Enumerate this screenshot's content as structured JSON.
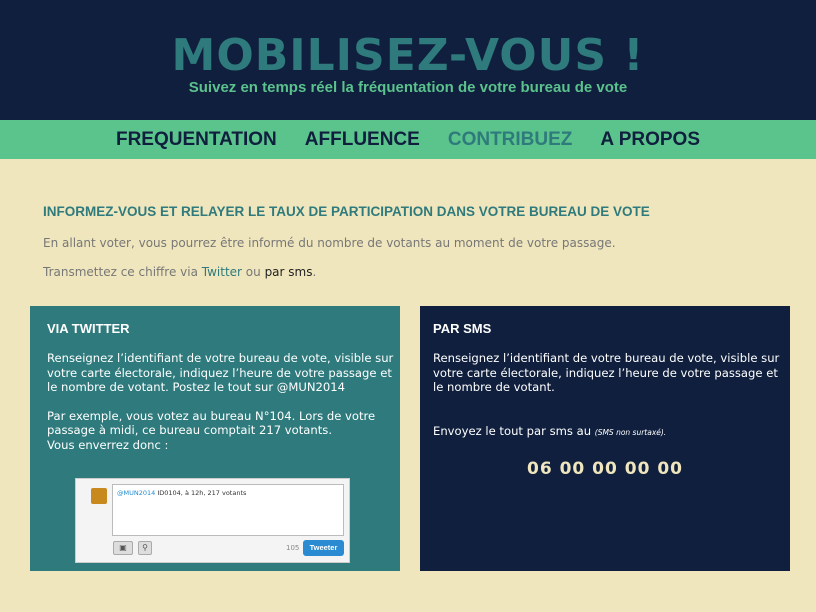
{
  "header": {
    "title": "MOBILISEZ-VOUS !",
    "subtitle": "Suivez en temps réel la fréquentation de votre bureau de vote"
  },
  "nav": {
    "items": [
      {
        "label": "FREQUENTATION",
        "active": false
      },
      {
        "label": "AFFLUENCE",
        "active": false
      },
      {
        "label": "CONTRIBUEZ",
        "active": true
      },
      {
        "label": "A PROPOS",
        "active": false
      }
    ]
  },
  "intro": {
    "title": "INFORMEZ-VOUS ET RELAYER LE TAUX DE PARTICIPATION DANS VOTRE BUREAU DE VOTE",
    "line1": "En allant voter, vous pourrez être informé du nombre de votants au moment de votre passage.",
    "line2_prefix": "Transmettez ce chiffre via ",
    "line2_twitter": "Twitter",
    "line2_middle": " ou ",
    "line2_sms": "par sms",
    "line2_suffix": "."
  },
  "twitter_panel": {
    "title": "VIA TWITTER",
    "text1": "Renseignez l’identifiant de votre bureau de vote, visible sur votre carte électorale, indiquez l’heure de votre passage et le nombre de votant. Postez le tout sur @MUN2014",
    "text2": "Par exemple, vous votez au bureau N°104. Lors de votre passage à midi, ce bureau comptait 217 votants.",
    "text3": "Vous enverrez donc :",
    "tweet": {
      "mention": "@MUN2014",
      "content": " ID0104, à 12h, 217 votants",
      "counter": "105",
      "button_label": "Tweeter"
    }
  },
  "sms_panel": {
    "title": "PAR SMS",
    "text1": "Renseignez l’identifiant de votre bureau de vote, visible sur votre carte électorale, indiquez l’heure de votre passage et le nombre de votant.",
    "send_text": "Envoyez le tout par sms au ",
    "note": "(SMS non surtaxé).",
    "number": "06 00 00 00 00"
  },
  "colors": {
    "header_bg": "#0f1f3d",
    "nav_bg": "#5bc48c",
    "accent": "#2e7a7c",
    "page_bg": "#f0e6bd"
  }
}
